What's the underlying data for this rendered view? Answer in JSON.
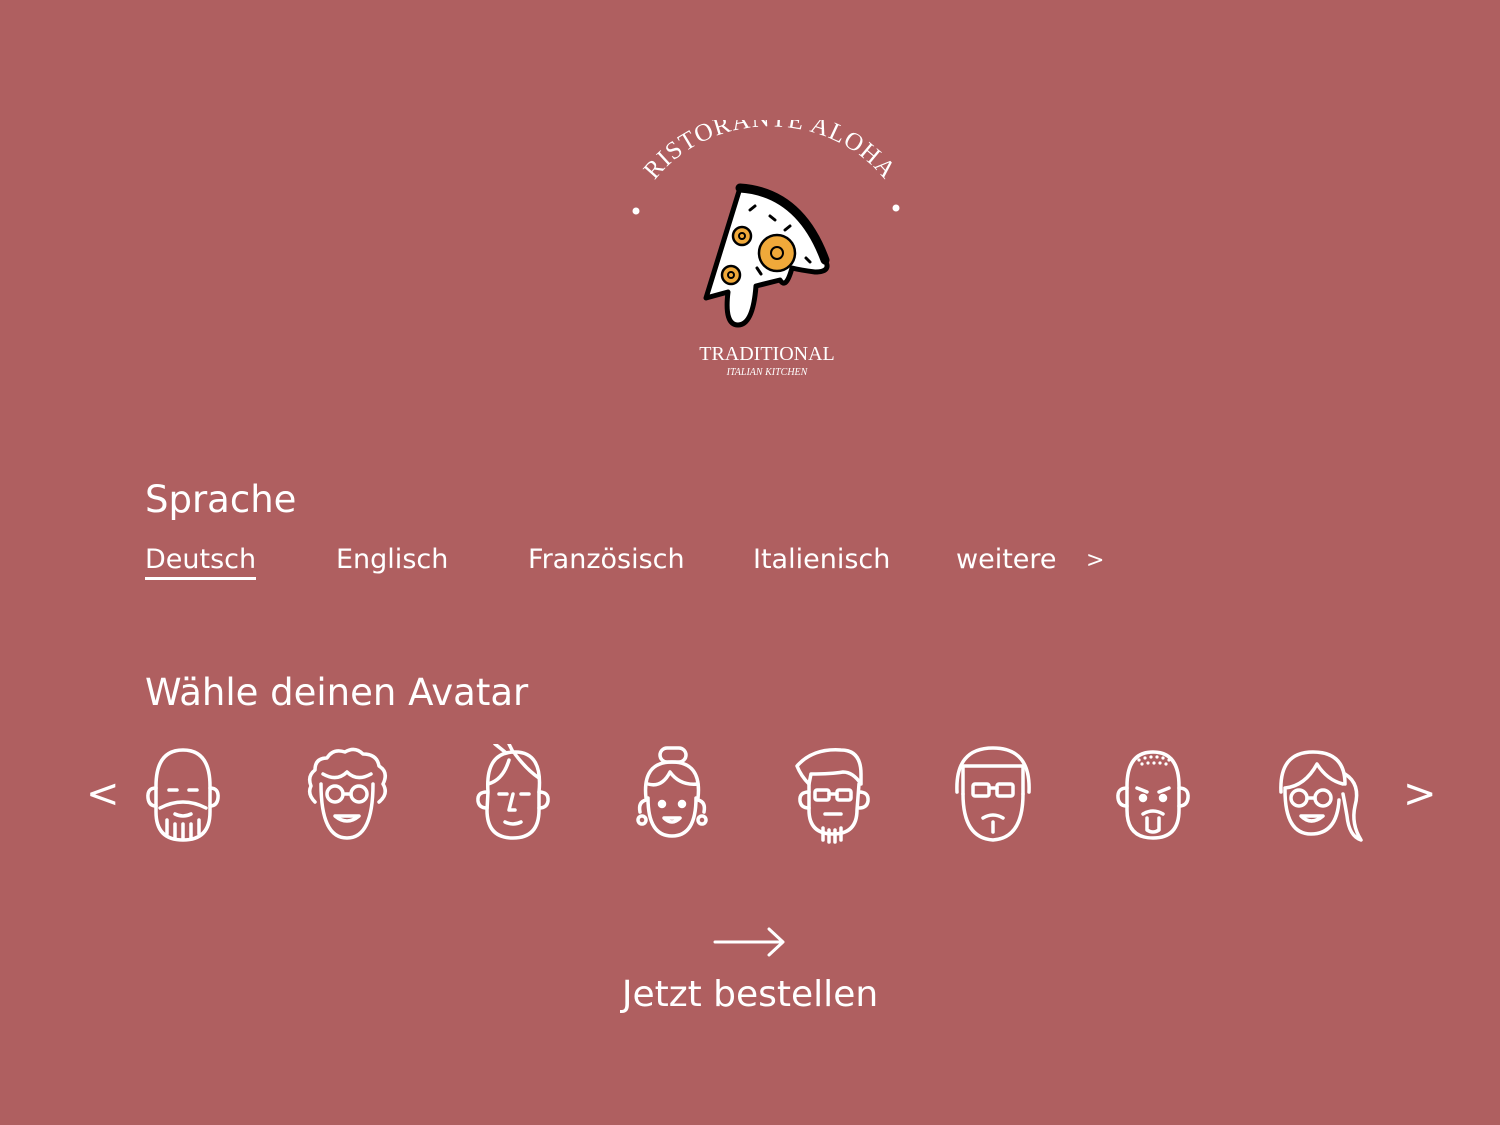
{
  "colors": {
    "background": "#AF5F60",
    "foreground": "#FFFFFF",
    "pineapple": "#F0A93A"
  },
  "logo": {
    "name_arc": "RISTORANTE ALOHA",
    "line1": "TRADITIONAL",
    "line2": "ITALIAN KITCHEN",
    "icon": "pizza-slice-icon"
  },
  "language": {
    "title": "Sprache",
    "options": [
      "Deutsch",
      "Englisch",
      "Französisch",
      "Italienisch",
      "weitere"
    ],
    "selected": "Deutsch",
    "more_glyph": ">"
  },
  "avatars": {
    "title": "Wähle deinen Avatar",
    "prev_glyph": "<",
    "next_glyph": ">",
    "items": [
      "bald-bearded-man-avatar-icon",
      "curly-hair-glasses-avatar-icon",
      "side-part-man-avatar-icon",
      "hair-bun-woman-avatar-icon",
      "quiff-glasses-man-avatar-icon",
      "bowl-cut-glasses-man-avatar-icon",
      "buzzcut-goatee-man-avatar-icon",
      "ponytail-glasses-woman-avatar-icon"
    ]
  },
  "cta": {
    "label": "Jetzt bestellen",
    "icon": "arrow-right-icon"
  }
}
